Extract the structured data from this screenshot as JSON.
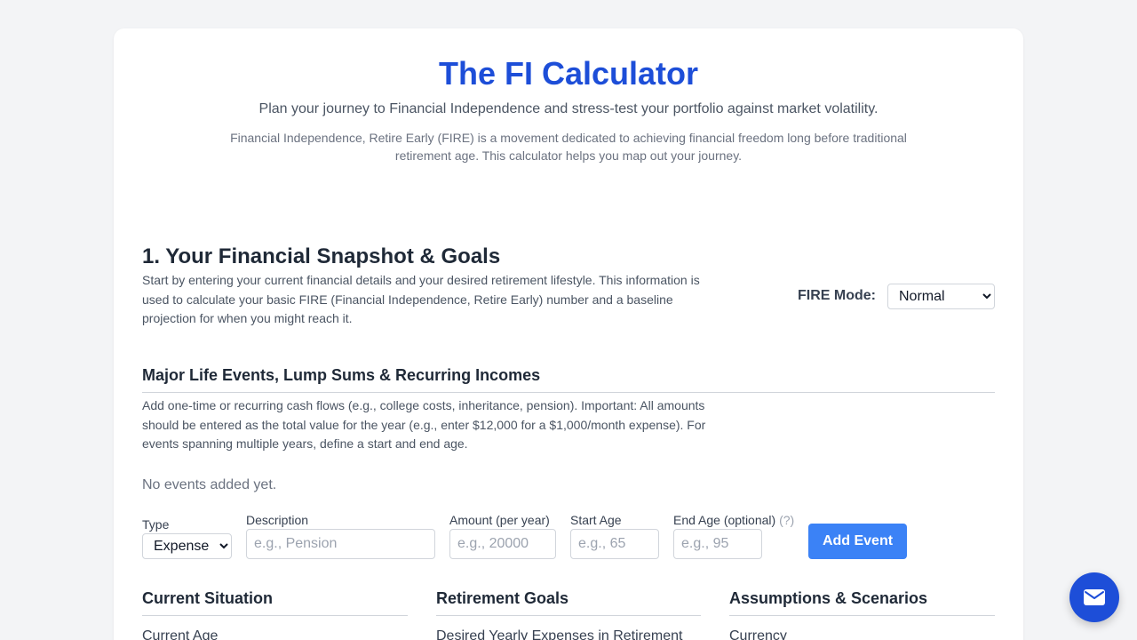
{
  "header": {
    "title": "The FI Calculator",
    "subtitle": "Plan your journey to Financial Independence and stress-test your portfolio against market volatility.",
    "intro": "Financial Independence, Retire Early (FIRE) is a movement dedicated to achieving financial freedom long before traditional retirement age. This calculator helps you map out your journey."
  },
  "section1": {
    "heading": "1. Your Financial Snapshot & Goals",
    "description": "Start by entering your current financial details and your desired retirement lifestyle. This information is used to calculate your basic FIRE (Financial Independence, Retire Early) number and a baseline projection for when you might reach it.",
    "fire_mode_label": "FIRE Mode:",
    "fire_mode_value": "Normal"
  },
  "events": {
    "heading": "Major Life Events, Lump Sums & Recurring Incomes",
    "description": "Add one-time or recurring cash flows (e.g., college costs, inheritance, pension). Important: All amounts should be entered as the total value for the year (e.g., enter $12,000 for a $1,000/month expense). For events spanning multiple years, define a start and end age.",
    "empty_text": "No events added yet.",
    "type_label": "Type",
    "type_value": "Expense",
    "description_label": "Description",
    "description_placeholder": "e.g., Pension",
    "amount_label": "Amount (per year)",
    "amount_placeholder": "e.g., 20000",
    "start_label": "Start Age",
    "start_placeholder": "e.g., 65",
    "end_label": "End Age (optional)",
    "end_help": "(?)",
    "end_placeholder": "e.g., 95",
    "add_button": "Add Event"
  },
  "columns": {
    "current": {
      "heading": "Current Situation",
      "first_label": "Current Age"
    },
    "goals": {
      "heading": "Retirement Goals",
      "first_label": "Desired Yearly Expenses in Retirement"
    },
    "assumptions": {
      "heading": "Assumptions & Scenarios",
      "first_label": "Currency"
    }
  },
  "icons": {
    "chat": "mail-icon"
  },
  "colors": {
    "accent": "#3b82f6",
    "title": "#1d4ed8",
    "chat": "#1d4ed8"
  }
}
